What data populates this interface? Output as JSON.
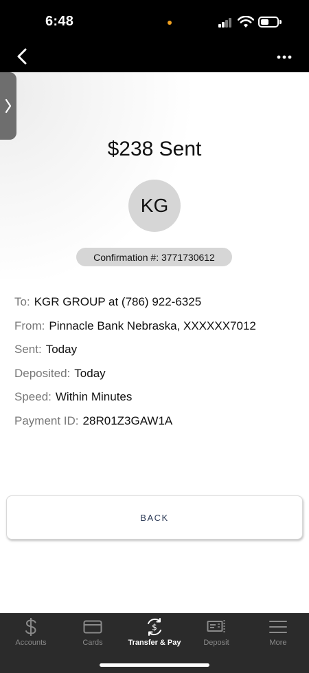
{
  "status_bar": {
    "time": "6:48"
  },
  "payment": {
    "title": "$238 Sent",
    "initials": "KG",
    "confirmation": "Confirmation #: 3771730612"
  },
  "details": [
    {
      "label": "To:",
      "value": "KGR GROUP at (786) 922-6325"
    },
    {
      "label": "From:",
      "value": "Pinnacle Bank Nebraska, XXXXXX7012"
    },
    {
      "label": "Sent:",
      "value": "Today"
    },
    {
      "label": "Deposited:",
      "value": "Today"
    },
    {
      "label": "Speed:",
      "value": "Within Minutes"
    },
    {
      "label": "Payment ID:",
      "value": "28R01Z3GAW1A"
    }
  ],
  "back_button": {
    "label": "BACK"
  },
  "tab_bar": {
    "active": "Transfer & Pay",
    "tabs": [
      {
        "label": "Accounts",
        "icon": "dollar-icon"
      },
      {
        "label": "Cards",
        "icon": "card-icon"
      },
      {
        "label": "Transfer & Pay",
        "icon": "transfer-pay-icon"
      },
      {
        "label": "Deposit",
        "icon": "deposit-check-icon"
      },
      {
        "label": "More",
        "icon": "menu-icon"
      }
    ]
  },
  "colors": {
    "button_text": "#2d3b57",
    "tab_bar_bg": "#2b2b2b",
    "pill_bg": "#d6d6d6",
    "status_dot": "#f0a020"
  }
}
